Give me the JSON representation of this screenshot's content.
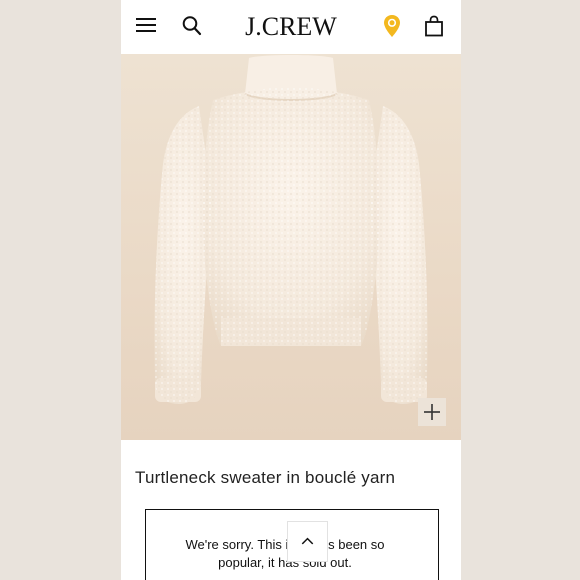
{
  "header": {
    "menu_icon": "hamburger-menu-icon",
    "search_icon": "search-icon",
    "brand": "J.CREW",
    "store_icon": "location-pin-icon",
    "bag_icon": "shopping-bag-icon",
    "accent_color": "#f3b81f"
  },
  "product": {
    "image_subject": "sweater",
    "title": "Turtleneck sweater in bouclé yarn",
    "zoom_icon": "plus-icon"
  },
  "notice": {
    "text": "We're sorry. This item has been so popular, it has sold out."
  },
  "scroll_top_icon": "chevron-up-icon"
}
